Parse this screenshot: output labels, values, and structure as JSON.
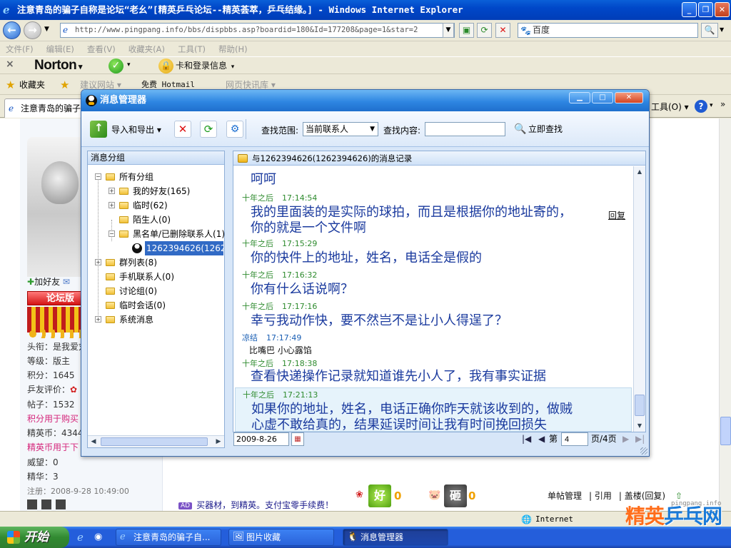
{
  "browser": {
    "title": "注意青岛的骗子自称是论坛“老幺”[精英乒乓论坛--精英荟萃，乒乓结缘。] - Windows Internet Explorer",
    "url": "http://www.pingpang.info/bbs/dispbbs.asp?boardid=180&Id=177208&page=1&star=2",
    "search_value": "百度",
    "menu": [
      "文件(F)",
      "编辑(E)",
      "查看(V)",
      "收藏夹(A)",
      "工具(T)",
      "帮助(H)"
    ],
    "norton_label": "Norton",
    "norton_login": "卡和登录信息",
    "favorites_label": "收藏夹",
    "fav_links": [
      "建议网站 ▾",
      "免费 Hotmail",
      "网页快讯库 ▾"
    ],
    "tab_title": "注意青岛的骗子",
    "tools_menu": "工具(O) ▾",
    "status_zone": "Internet"
  },
  "profile": {
    "add_friend": "加好友",
    "badge": "论坛版",
    "lines": [
      {
        "text": "头衔：是我爱刘",
        "style": ""
      },
      {
        "text": "等级：版主",
        "style": ""
      },
      {
        "text": "积分：1645",
        "style": ""
      },
      {
        "text": "乒友评价：",
        "style": ""
      },
      {
        "text": "帖子：1532",
        "style": "green"
      },
      {
        "text": "积分用于购买",
        "style": "pink"
      },
      {
        "text": "精英币：4344",
        "style": ""
      },
      {
        "text": "精英币用于下",
        "style": "pink"
      },
      {
        "text": "威望：0",
        "style": ""
      },
      {
        "text": "精华：3",
        "style": ""
      },
      {
        "text": "注册：2008-9-28 10:49:00",
        "style": "small"
      }
    ]
  },
  "post": {
    "ad_badge": "AD",
    "ad_text": "买器材，到精英。支付宝零手续费！",
    "good_label": "好",
    "good_count": "0",
    "bad_label": "砸",
    "bad_count": "0",
    "actions": [
      "单帖管理",
      "引用",
      "盖楼(回复)"
    ]
  },
  "watermark": {
    "text_a": "精英",
    "text_b": "乒乓网",
    "url": "pingpang.info"
  },
  "taskbar": {
    "start": "开始",
    "tasks": [
      "注意青岛的骗子自...",
      "图片收藏",
      "消息管理器"
    ]
  },
  "qq": {
    "title": "消息管理器",
    "toolbar": {
      "export_label": "导入和导出 ▾",
      "scope_label": "查找范围:",
      "scope_value": "当前联系人",
      "content_label": "查找内容:",
      "content_value": "",
      "find_label": "立即查找"
    },
    "tree": {
      "header": "消息分组",
      "nodes": [
        {
          "label": "所有分组",
          "exp": "−"
        },
        {
          "label": "我的好友(165)",
          "exp": "+"
        },
        {
          "label": "临时(62)",
          "exp": "+"
        },
        {
          "label": "陌生人(0)",
          "exp": ""
        },
        {
          "label": "黑名单/已删除联系人(1)",
          "exp": "−"
        },
        {
          "label": "1262394626(1262394626)",
          "exp": ""
        },
        {
          "label": "群列表(8)",
          "exp": "+"
        },
        {
          "label": "手机联系人(0)",
          "exp": ""
        },
        {
          "label": "讨论组(0)",
          "exp": ""
        },
        {
          "label": "临时会话(0)",
          "exp": ""
        },
        {
          "label": "系统消息",
          "exp": "+"
        }
      ]
    },
    "msg_header": "与1262394626(1262394626)的消息记录",
    "reply_label": "回复",
    "messages": [
      {
        "sender": "",
        "time": "",
        "text": "呵呵",
        "style": "big"
      },
      {
        "sender": "十年之后",
        "time": "17:14:54",
        "text": "我的里面装的是实际的球拍，而且是根据你的地址寄的，\n你的就是一个文件啊",
        "style": "big"
      },
      {
        "sender": "十年之后",
        "time": "17:15:29",
        "text": "你的快件上的地址，姓名，电话全是假的",
        "style": "big"
      },
      {
        "sender": "十年之后",
        "time": "17:16:32",
        "text": "你有什么话说啊？",
        "style": "big"
      },
      {
        "sender": "十年之后",
        "time": "17:17:16",
        "text": "幸亏我动作快，要不然岂不是让小人得逞了？",
        "style": "big"
      },
      {
        "sender": "凉结",
        "time": "17:17:49",
        "text": "比嘴巴   小心露馅",
        "style": "small"
      },
      {
        "sender": "十年之后",
        "time": "17:18:38",
        "text": "查看快递操作记录就知道谁先小人了，我有事实证据",
        "style": "big"
      },
      {
        "sender": "十年之后",
        "time": "17:21:13",
        "text": "如果你的地址，姓名，电话正确你昨天就该收到的，做贼\n心虚不敢给真的，结果延误时间让我有时间挽回损失",
        "style": "big"
      }
    ],
    "pager": {
      "date": "2009-8-26",
      "page_label": "第",
      "page_value": "4",
      "page_total": "页/4页"
    }
  }
}
